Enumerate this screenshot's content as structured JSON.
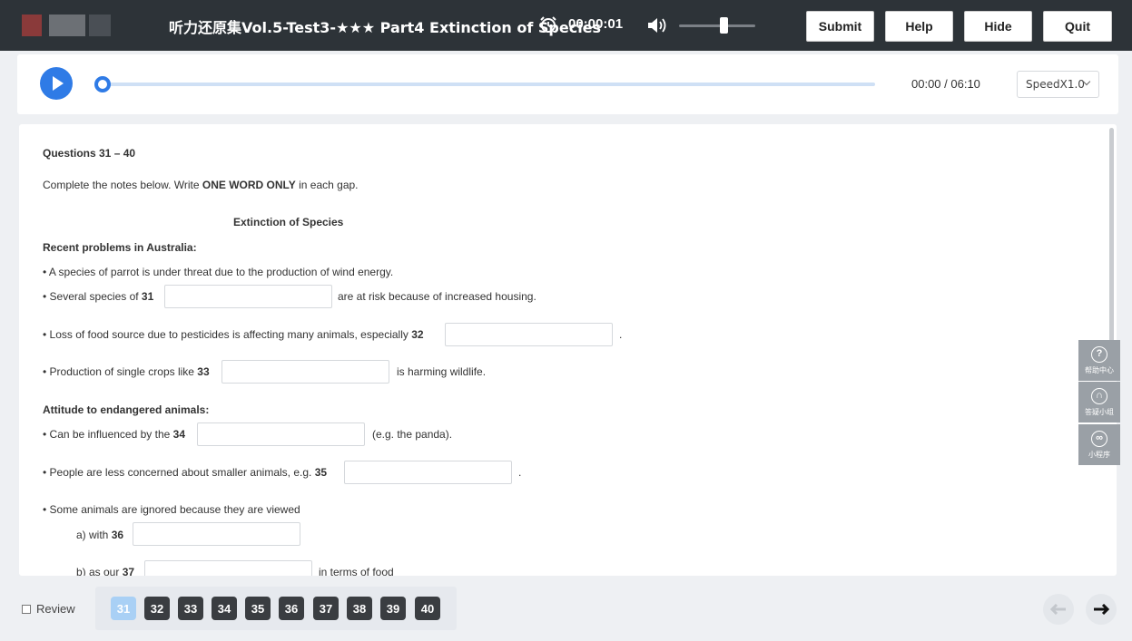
{
  "header": {
    "title": "听力还原集Vol.5-Test3-★★★ Part4 Extinction of Species",
    "timer": "00:00:01",
    "buttons": {
      "submit": "Submit",
      "help": "Help",
      "hide": "Hide",
      "quit": "Quit"
    },
    "volume_level": 0.55
  },
  "audio": {
    "time": "00:00 / 06:10",
    "speed": "SpeedX1.0",
    "progress": 0
  },
  "content": {
    "questions_heading": "Questions 31 – 40",
    "instruction_pre": "Complete the notes below. Write ",
    "instruction_bold": "ONE WORD ONLY",
    "instruction_post": " in each gap.",
    "notes_title": "Extinction of Species",
    "section1": "Recent problems in Australia:",
    "l1": "• A species of parrot is under threat due to the production of wind energy.",
    "l2_pre": "• Several species of ",
    "l2_num": "31",
    "l2_post": "are at risk because of increased housing.",
    "l3_pre": "• Loss of food source due to pesticides is affecting many animals, especially ",
    "l3_num": "32",
    "l3_post": ".",
    "l4_pre": "• Production of single crops like ",
    "l4_num": "33",
    "l4_post": "is harming wildlife.",
    "section2": "Attitude to endangered animals:",
    "l5_pre": "• Can be influenced by the ",
    "l5_num": "34",
    "l5_post": "(e.g. the panda).",
    "l6_pre": "• People are less concerned about smaller animals, e.g. ",
    "l6_num": "35",
    "l6_post": ".",
    "l7": "• Some animals are ignored because they are viewed",
    "l8_pre": "a) with ",
    "l8_num": "36",
    "l9_pre": "b) as our ",
    "l9_num": "37",
    "l9_post": "in terms of food"
  },
  "widgets": [
    {
      "icon": "question-icon",
      "glyph": "?",
      "label": "帮助中心"
    },
    {
      "icon": "headset-icon",
      "glyph": "∩",
      "label": "答疑小组"
    },
    {
      "icon": "link-icon",
      "glyph": "∞",
      "label": "小程序"
    }
  ],
  "footer": {
    "review_label": "Review",
    "questions": [
      "31",
      "32",
      "33",
      "34",
      "35",
      "36",
      "37",
      "38",
      "39",
      "40"
    ],
    "active_question": "31",
    "prev_arrow": "🡐",
    "next_arrow": "🡒"
  }
}
